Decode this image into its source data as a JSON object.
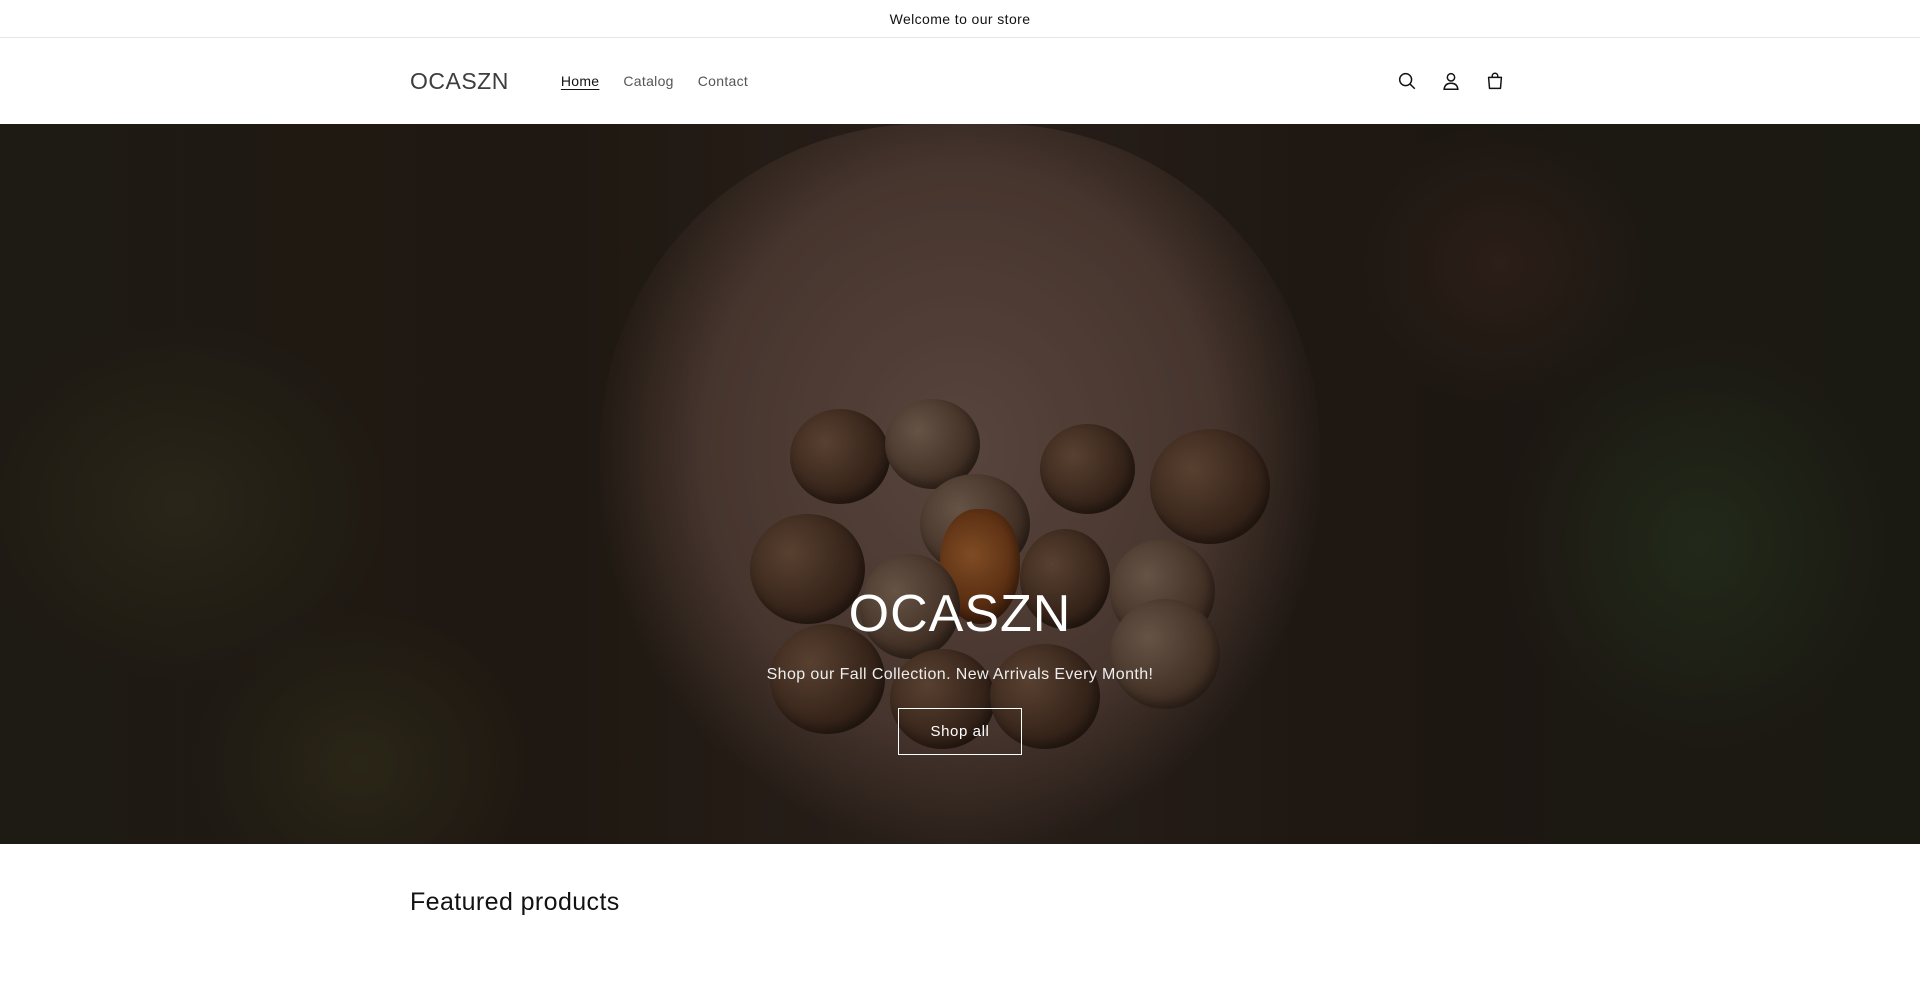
{
  "announcement": {
    "text": "Welcome to our store"
  },
  "header": {
    "logo": "OCASZN",
    "nav": [
      {
        "label": "Home",
        "active": true
      },
      {
        "label": "Catalog",
        "active": false
      },
      {
        "label": "Contact",
        "active": false
      }
    ],
    "icons": [
      "search-icon",
      "account-icon",
      "cart-icon"
    ]
  },
  "hero": {
    "title": "OCASZN",
    "subtitle": "Shop our Fall Collection. New Arrivals Every Month!",
    "button_label": "Shop all"
  },
  "featured": {
    "title": "Featured products"
  }
}
